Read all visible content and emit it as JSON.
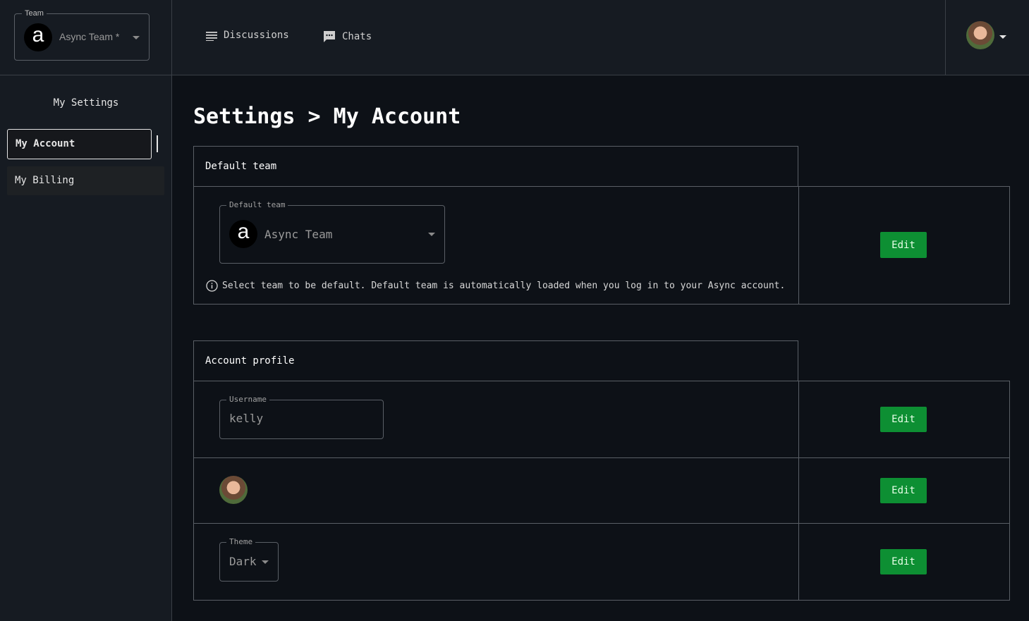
{
  "sidebar": {
    "team_legend": "Team",
    "team_name": "Async Team *",
    "team_logo_letter": "a",
    "section_title": "My Settings",
    "items": [
      {
        "label": "My Account",
        "active": true
      },
      {
        "label": "My Billing",
        "active": false
      }
    ]
  },
  "topnav": {
    "discussions": "Discussions",
    "chats": "Chats"
  },
  "page": {
    "title": "Settings > My Account"
  },
  "default_team_section": {
    "header": "Default team",
    "field_legend": "Default team",
    "logo_letter": "a",
    "value": "Async Team",
    "helper": "Select team to be default. Default team is automatically loaded when you log in to your Async account.",
    "edit_label": "Edit"
  },
  "account_profile_section": {
    "header": "Account profile",
    "username_legend": "Username",
    "username_value": "kelly",
    "username_edit": "Edit",
    "avatar_edit": "Edit",
    "theme_legend": "Theme",
    "theme_value": "Dark",
    "theme_edit": "Edit"
  },
  "colors": {
    "background": "#0d1117",
    "panel": "#161b22",
    "accent_green": "#0d8f33"
  }
}
